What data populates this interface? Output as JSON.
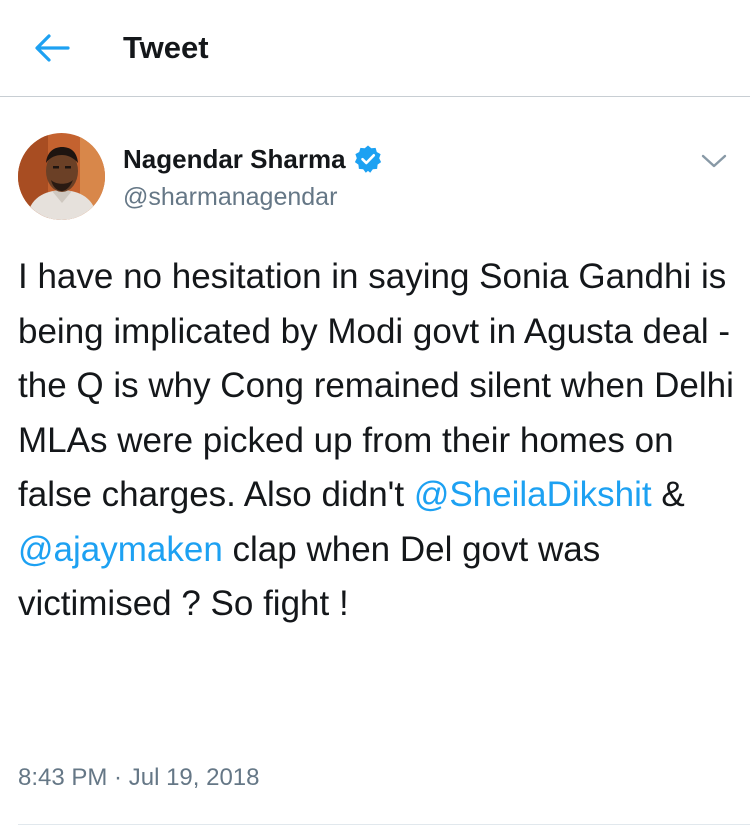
{
  "header": {
    "title": "Tweet"
  },
  "tweet": {
    "author_name": "Nagendar Sharma",
    "author_handle": "@sharmanagendar",
    "text_1": "I have no hesitation in saying Sonia Gandhi is being implicated by Modi govt in Agusta deal - the Q is why Cong remained silent when Delhi MLAs were picked up from their homes on false charges. Also didn't ",
    "mention_1": "@SheilaDikshit",
    "text_2": " & ",
    "mention_2": "@ajaymaken",
    "text_3": " clap when Del govt was victimised ? So fight !",
    "time": "8:43 PM",
    "separator": " · ",
    "date": "Jul 19, 2018"
  },
  "icons": {
    "back": "arrow-left-icon",
    "verified": "verified-badge-icon",
    "more": "chevron-down-icon"
  },
  "colors": {
    "accent": "#1da1f2",
    "text": "#14171a",
    "secondary": "#657786"
  }
}
